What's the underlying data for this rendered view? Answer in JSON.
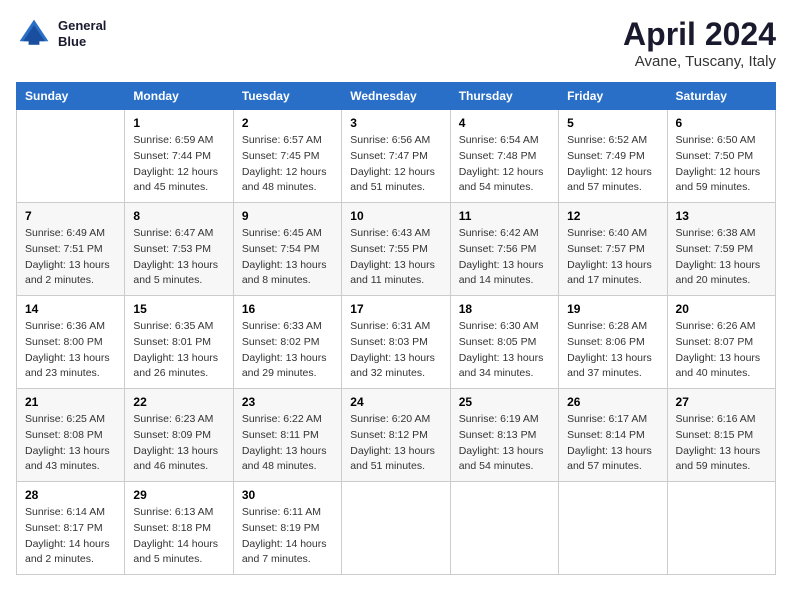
{
  "header": {
    "logo_line1": "General",
    "logo_line2": "Blue",
    "title": "April 2024",
    "subtitle": "Avane, Tuscany, Italy"
  },
  "weekdays": [
    "Sunday",
    "Monday",
    "Tuesday",
    "Wednesday",
    "Thursday",
    "Friday",
    "Saturday"
  ],
  "weeks": [
    [
      {
        "day": "",
        "sunrise": "",
        "sunset": "",
        "daylight": ""
      },
      {
        "day": "1",
        "sunrise": "Sunrise: 6:59 AM",
        "sunset": "Sunset: 7:44 PM",
        "daylight": "Daylight: 12 hours and 45 minutes."
      },
      {
        "day": "2",
        "sunrise": "Sunrise: 6:57 AM",
        "sunset": "Sunset: 7:45 PM",
        "daylight": "Daylight: 12 hours and 48 minutes."
      },
      {
        "day": "3",
        "sunrise": "Sunrise: 6:56 AM",
        "sunset": "Sunset: 7:47 PM",
        "daylight": "Daylight: 12 hours and 51 minutes."
      },
      {
        "day": "4",
        "sunrise": "Sunrise: 6:54 AM",
        "sunset": "Sunset: 7:48 PM",
        "daylight": "Daylight: 12 hours and 54 minutes."
      },
      {
        "day": "5",
        "sunrise": "Sunrise: 6:52 AM",
        "sunset": "Sunset: 7:49 PM",
        "daylight": "Daylight: 12 hours and 57 minutes."
      },
      {
        "day": "6",
        "sunrise": "Sunrise: 6:50 AM",
        "sunset": "Sunset: 7:50 PM",
        "daylight": "Daylight: 12 hours and 59 minutes."
      }
    ],
    [
      {
        "day": "7",
        "sunrise": "Sunrise: 6:49 AM",
        "sunset": "Sunset: 7:51 PM",
        "daylight": "Daylight: 13 hours and 2 minutes."
      },
      {
        "day": "8",
        "sunrise": "Sunrise: 6:47 AM",
        "sunset": "Sunset: 7:53 PM",
        "daylight": "Daylight: 13 hours and 5 minutes."
      },
      {
        "day": "9",
        "sunrise": "Sunrise: 6:45 AM",
        "sunset": "Sunset: 7:54 PM",
        "daylight": "Daylight: 13 hours and 8 minutes."
      },
      {
        "day": "10",
        "sunrise": "Sunrise: 6:43 AM",
        "sunset": "Sunset: 7:55 PM",
        "daylight": "Daylight: 13 hours and 11 minutes."
      },
      {
        "day": "11",
        "sunrise": "Sunrise: 6:42 AM",
        "sunset": "Sunset: 7:56 PM",
        "daylight": "Daylight: 13 hours and 14 minutes."
      },
      {
        "day": "12",
        "sunrise": "Sunrise: 6:40 AM",
        "sunset": "Sunset: 7:57 PM",
        "daylight": "Daylight: 13 hours and 17 minutes."
      },
      {
        "day": "13",
        "sunrise": "Sunrise: 6:38 AM",
        "sunset": "Sunset: 7:59 PM",
        "daylight": "Daylight: 13 hours and 20 minutes."
      }
    ],
    [
      {
        "day": "14",
        "sunrise": "Sunrise: 6:36 AM",
        "sunset": "Sunset: 8:00 PM",
        "daylight": "Daylight: 13 hours and 23 minutes."
      },
      {
        "day": "15",
        "sunrise": "Sunrise: 6:35 AM",
        "sunset": "Sunset: 8:01 PM",
        "daylight": "Daylight: 13 hours and 26 minutes."
      },
      {
        "day": "16",
        "sunrise": "Sunrise: 6:33 AM",
        "sunset": "Sunset: 8:02 PM",
        "daylight": "Daylight: 13 hours and 29 minutes."
      },
      {
        "day": "17",
        "sunrise": "Sunrise: 6:31 AM",
        "sunset": "Sunset: 8:03 PM",
        "daylight": "Daylight: 13 hours and 32 minutes."
      },
      {
        "day": "18",
        "sunrise": "Sunrise: 6:30 AM",
        "sunset": "Sunset: 8:05 PM",
        "daylight": "Daylight: 13 hours and 34 minutes."
      },
      {
        "day": "19",
        "sunrise": "Sunrise: 6:28 AM",
        "sunset": "Sunset: 8:06 PM",
        "daylight": "Daylight: 13 hours and 37 minutes."
      },
      {
        "day": "20",
        "sunrise": "Sunrise: 6:26 AM",
        "sunset": "Sunset: 8:07 PM",
        "daylight": "Daylight: 13 hours and 40 minutes."
      }
    ],
    [
      {
        "day": "21",
        "sunrise": "Sunrise: 6:25 AM",
        "sunset": "Sunset: 8:08 PM",
        "daylight": "Daylight: 13 hours and 43 minutes."
      },
      {
        "day": "22",
        "sunrise": "Sunrise: 6:23 AM",
        "sunset": "Sunset: 8:09 PM",
        "daylight": "Daylight: 13 hours and 46 minutes."
      },
      {
        "day": "23",
        "sunrise": "Sunrise: 6:22 AM",
        "sunset": "Sunset: 8:11 PM",
        "daylight": "Daylight: 13 hours and 48 minutes."
      },
      {
        "day": "24",
        "sunrise": "Sunrise: 6:20 AM",
        "sunset": "Sunset: 8:12 PM",
        "daylight": "Daylight: 13 hours and 51 minutes."
      },
      {
        "day": "25",
        "sunrise": "Sunrise: 6:19 AM",
        "sunset": "Sunset: 8:13 PM",
        "daylight": "Daylight: 13 hours and 54 minutes."
      },
      {
        "day": "26",
        "sunrise": "Sunrise: 6:17 AM",
        "sunset": "Sunset: 8:14 PM",
        "daylight": "Daylight: 13 hours and 57 minutes."
      },
      {
        "day": "27",
        "sunrise": "Sunrise: 6:16 AM",
        "sunset": "Sunset: 8:15 PM",
        "daylight": "Daylight: 13 hours and 59 minutes."
      }
    ],
    [
      {
        "day": "28",
        "sunrise": "Sunrise: 6:14 AM",
        "sunset": "Sunset: 8:17 PM",
        "daylight": "Daylight: 14 hours and 2 minutes."
      },
      {
        "day": "29",
        "sunrise": "Sunrise: 6:13 AM",
        "sunset": "Sunset: 8:18 PM",
        "daylight": "Daylight: 14 hours and 5 minutes."
      },
      {
        "day": "30",
        "sunrise": "Sunrise: 6:11 AM",
        "sunset": "Sunset: 8:19 PM",
        "daylight": "Daylight: 14 hours and 7 minutes."
      },
      {
        "day": "",
        "sunrise": "",
        "sunset": "",
        "daylight": ""
      },
      {
        "day": "",
        "sunrise": "",
        "sunset": "",
        "daylight": ""
      },
      {
        "day": "",
        "sunrise": "",
        "sunset": "",
        "daylight": ""
      },
      {
        "day": "",
        "sunrise": "",
        "sunset": "",
        "daylight": ""
      }
    ]
  ]
}
